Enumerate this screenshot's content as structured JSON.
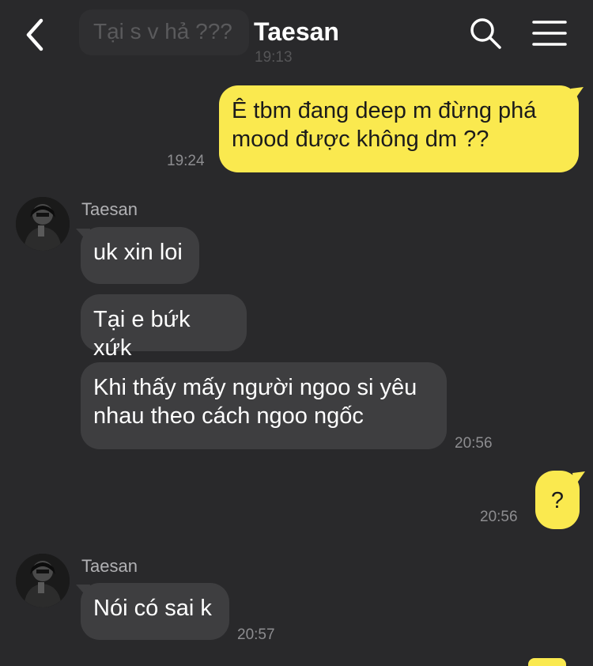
{
  "header": {
    "title": "Taesan",
    "back_icon": "chevron-left-icon",
    "search_icon": "search-icon",
    "menu_icon": "hamburger-menu-icon",
    "ghost_message": "Tại s v hả ???",
    "ghost_time": "19:13"
  },
  "colors": {
    "background": "#29292b",
    "incoming_bubble": "#3e3e40",
    "outgoing_bubble": "#fae94f"
  },
  "messages": [
    {
      "from": "me",
      "text": "Ê tbm đang deep m đừng phá mood được không dm ??",
      "time": "19:24"
    },
    {
      "from": "Taesan",
      "sender_name": "Taesan",
      "texts": [
        "uk xin loi",
        "Tại e bứk xứk",
        "Khi thấy mấy người ngoo si yêu nhau theo cách ngoo ngốc"
      ],
      "time": "20:56"
    },
    {
      "from": "me",
      "text": "?",
      "time": "20:56"
    },
    {
      "from": "Taesan",
      "sender_name": "Taesan",
      "texts": [
        "Nói có sai k"
      ],
      "time": "20:57"
    }
  ]
}
